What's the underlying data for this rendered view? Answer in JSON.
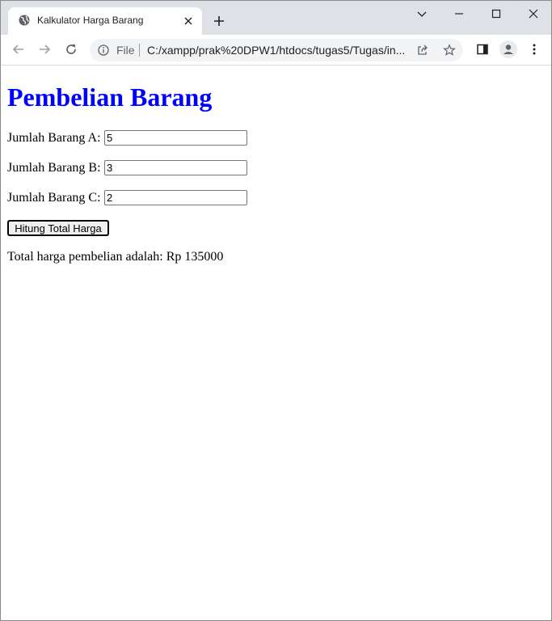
{
  "browser": {
    "tab_title": "Kalkulator Harga Barang",
    "url_scheme": "File",
    "url": "C:/xampp/prak%20DPW1/htdocs/tugas5/Tugas/in..."
  },
  "page": {
    "heading": "Pembelian Barang",
    "fields": [
      {
        "label": "Jumlah Barang A:",
        "value": "5"
      },
      {
        "label": "Jumlah Barang B:",
        "value": "3"
      },
      {
        "label": "Jumlah Barang C:",
        "value": "2"
      }
    ],
    "submit_label": "Hitung Total Harga",
    "result_text": "Total harga pembelian adalah: Rp 135000"
  },
  "colors": {
    "heading": "#0000ff",
    "tabstrip": "#dee1e6",
    "omnibox": "#f1f3f4"
  }
}
